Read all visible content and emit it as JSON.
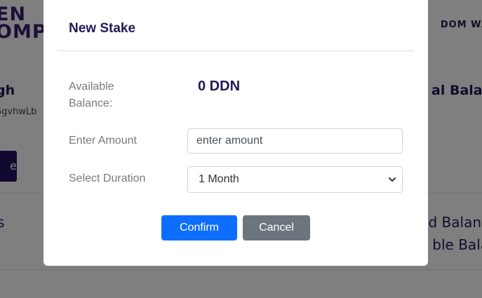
{
  "background": {
    "logo_line1": "EN",
    "logo_line2": "OMP",
    "nav_item": "DOM WA",
    "card_title": "gh",
    "card_sub": "GgvhwLb",
    "card_button": "e",
    "right_title": "al Balar",
    "section_left": "s",
    "section_right_1": "d Balanc",
    "section_right_2": "ble Bala"
  },
  "modal": {
    "title": "New Stake",
    "available_balance_label": "Available Balance:",
    "available_balance_value": "0 DDN",
    "amount_label": "Enter Amount",
    "amount_placeholder": "enter amount",
    "amount_value": "",
    "duration_label": "Select Duration",
    "duration_value": "1 Month",
    "confirm_label": "Confirm",
    "cancel_label": "Cancel"
  },
  "colors": {
    "primary": "#0d6efd",
    "secondary": "#6c757d",
    "heading": "#1f1b5a"
  }
}
